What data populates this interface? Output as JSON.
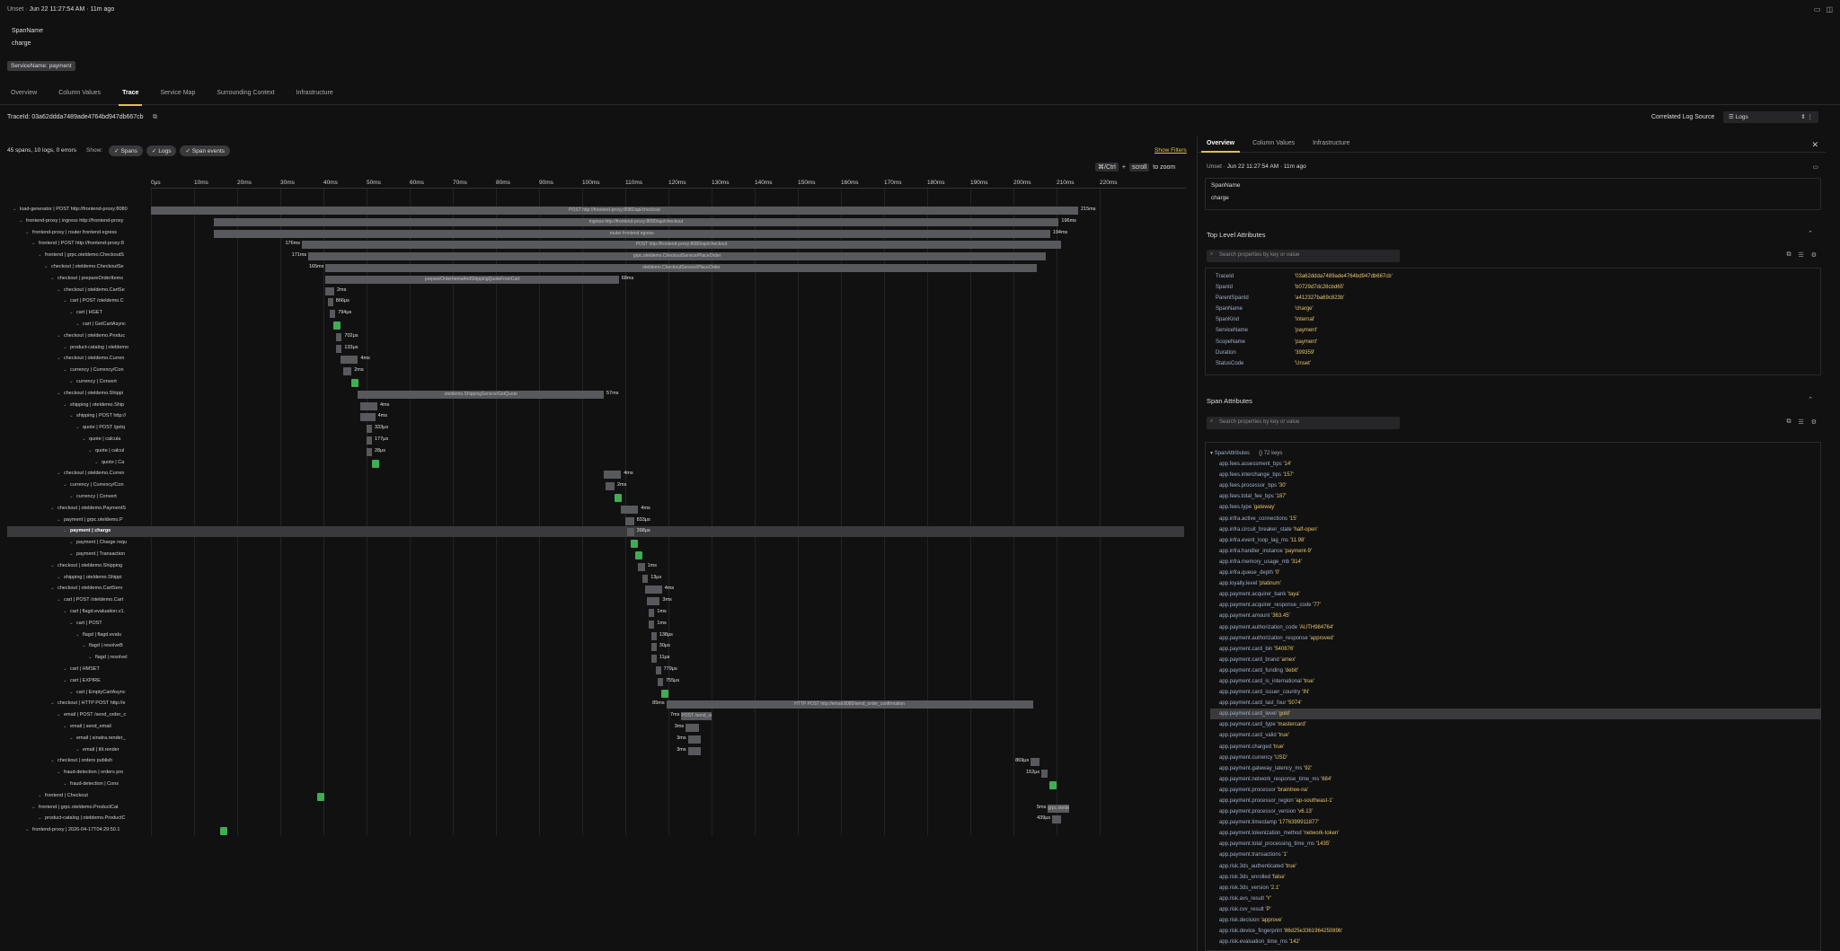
{
  "header": {
    "source": "Unset",
    "timestamp": "Jun 22 11:27:54 AM · 11m ago",
    "span_name_label": "SpanName",
    "span_name_value": "charge",
    "service_chip": "ServiceName: payment"
  },
  "tabs": [
    "Overview",
    "Column Values",
    "Trace",
    "Service Map",
    "Surrounding Context",
    "Infrastructure"
  ],
  "trace": {
    "trace_id_label": "TraceId: 03a62ddda7489ade4764bd947db667cb",
    "summary": "45 spans, 10 logs, 0 errors",
    "show_label": "Show:",
    "filters": [
      "Spans",
      "Logs",
      "Span events"
    ],
    "show_filters": "Show Filters",
    "zoom_hint_key1": "⌘/Ctrl",
    "zoom_plus": "+",
    "zoom_hint_key2": "scroll",
    "zoom_hint_text": "to zoom",
    "correlated_label": "Correlated Log Source",
    "correlated_value": "Logs"
  },
  "axis_ticks": [
    "0μs",
    "10ms",
    "20ms",
    "30ms",
    "40ms",
    "50ms",
    "60ms",
    "70ms",
    "80ms",
    "90ms",
    "100ms",
    "110ms",
    "120ms",
    "130ms",
    "140ms",
    "150ms",
    "160ms",
    "170ms",
    "180ms",
    "190ms",
    "200ms",
    "210ms",
    "220ms"
  ],
  "spans": [
    {
      "label": "load-generator | POST http://frontend-proxy:8080",
      "indent": 0,
      "bs": 0,
      "bw": 215,
      "bar_text": "POST http://frontend-proxy:8080/api/checkout",
      "dur": "215ms",
      "durside": "right"
    },
    {
      "label": "frontend-proxy | ingress http://frontend-proxy",
      "indent": 1,
      "bs": 14.5,
      "bw": 196,
      "bar_text": "ingress http://frontend-proxy:8080/api/checkout",
      "dur": "196ms",
      "durside": "right"
    },
    {
      "label": "frontend-proxy | router frontend egress",
      "indent": 2,
      "bs": 14.5,
      "bw": 194,
      "bar_text": "router frontend egress",
      "dur": "194ms",
      "durside": "right"
    },
    {
      "label": "frontend | POST http://frontend-proxy:8",
      "indent": 3,
      "bs": 35,
      "bw": 176,
      "bar_text": "POST http://frontend-proxy:8080/api/checkout",
      "dur": "176ms",
      "durside": "left"
    },
    {
      "label": "frontend | grpc.oteldemo.CheckoutS",
      "indent": 4,
      "bs": 36.5,
      "bw": 171,
      "bar_text": "grpc.oteldemo.CheckoutService/PlaceOrder",
      "dur": "171ms",
      "durside": "left"
    },
    {
      "label": "checkout | oteldemo.CheckoutSe",
      "indent": 5,
      "bs": 40.5,
      "bw": 165,
      "bar_text": "oteldemo.CheckoutService/PlaceOrder",
      "dur": "165ms",
      "durside": "left"
    },
    {
      "label": "checkout | prepareOrderItems",
      "indent": 6,
      "bs": 40.5,
      "bw": 68,
      "bar_text": "prepareOrderItemsAndShippingQuoteFromCart",
      "dur": "68ms",
      "durside": "right"
    },
    {
      "label": "checkout | oteldemo.CartSe",
      "indent": 7,
      "bs": 40.5,
      "bw": 2,
      "bar_text": "",
      "dur": "2ms",
      "durside": "right"
    },
    {
      "label": "cart | POST /oteldemo.C",
      "indent": 8,
      "bs": 41,
      "bw": 1.2,
      "bar_text": "",
      "dur": "866μs",
      "durside": "right"
    },
    {
      "label": "cart | HGET",
      "indent": 9,
      "bs": 41.5,
      "bw": 1,
      "bar_text": "",
      "dur": "794μs",
      "durside": "right"
    },
    {
      "label": "cart | GetCartAsync",
      "indent": 10,
      "bs": 42,
      "bw": 0,
      "bar_text": "",
      "dur": "",
      "durside": "",
      "ev": 42.3
    },
    {
      "label": "checkout | oteldemo.Produc",
      "indent": 7,
      "bs": 43,
      "bw": 1,
      "bar_text": "",
      "dur": "702μs",
      "durside": "right"
    },
    {
      "label": "product-catalog | oteldemo",
      "indent": 8,
      "bs": 43,
      "bw": 0.6,
      "bar_text": "",
      "dur": "133μs",
      "durside": "right"
    },
    {
      "label": "checkout | oteldemo.Curren",
      "indent": 7,
      "bs": 44,
      "bw": 4,
      "bar_text": "",
      "dur": "4ms",
      "durside": "right"
    },
    {
      "label": "currency | Currency/Con",
      "indent": 8,
      "bs": 44.5,
      "bw": 2,
      "bar_text": "",
      "dur": "2ms",
      "durside": "right"
    },
    {
      "label": "currency | Convert",
      "indent": 9,
      "bs": 0,
      "bw": 0,
      "bar_text": "",
      "dur": "",
      "durside": "",
      "ev": 46.5
    },
    {
      "label": "checkout | oteldemo.Shippi",
      "indent": 7,
      "bs": 48,
      "bw": 57,
      "bar_text": "oteldemo.ShippingService/GetQuote",
      "dur": "57ms",
      "durside": "right"
    },
    {
      "label": "shipping | oteldemo.Ship",
      "indent": 8,
      "bs": 48.5,
      "bw": 4,
      "bar_text": "",
      "dur": "4ms",
      "durside": "right"
    },
    {
      "label": "shipping | POST http://",
      "indent": 9,
      "bs": 48.5,
      "bw": 3.5,
      "bar_text": "",
      "dur": "4ms",
      "durside": "right"
    },
    {
      "label": "quote | POST /getq",
      "indent": 10,
      "bs": 50,
      "bw": 0.8,
      "bar_text": "",
      "dur": "333μs",
      "durside": "right"
    },
    {
      "label": "quote | calcula",
      "indent": 11,
      "bs": 50,
      "bw": 0.6,
      "bar_text": "",
      "dur": "177μs",
      "durside": "right"
    },
    {
      "label": "quote | calcul",
      "indent": 12,
      "bs": 50,
      "bw": 0.5,
      "bar_text": "",
      "dur": "28μs",
      "durside": "right"
    },
    {
      "label": "quote | Ca",
      "indent": 13,
      "bs": 0,
      "bw": 0,
      "bar_text": "",
      "dur": "",
      "durside": "",
      "ev": 51.2
    },
    {
      "label": "checkout | oteldemo.Curren",
      "indent": 7,
      "bs": 105,
      "bw": 4,
      "bar_text": "",
      "dur": "4ms",
      "durside": "right"
    },
    {
      "label": "currency | Currency/Con",
      "indent": 8,
      "bs": 105.5,
      "bw": 2,
      "bar_text": "",
      "dur": "2ms",
      "durside": "right"
    },
    {
      "label": "currency | Convert",
      "indent": 9,
      "bs": 0,
      "bw": 0,
      "bar_text": "",
      "dur": "",
      "durside": "",
      "ev": 107.5
    },
    {
      "label": "checkout | oteldemo.PaymentS",
      "indent": 6,
      "bs": 109,
      "bw": 4,
      "bar_text": "",
      "dur": "4ms",
      "durside": "right"
    },
    {
      "label": "payment | grpc.oteldemo.P",
      "indent": 7,
      "bs": 110,
      "bw": 2,
      "bar_text": "",
      "dur": "833μs",
      "durside": "right"
    },
    {
      "label": "payment | charge",
      "indent": 8,
      "bs": 110.5,
      "bw": 1.5,
      "bar_text": "",
      "dur": "398μs",
      "durside": "right",
      "sel": true
    },
    {
      "label": "payment | Charge requ",
      "indent": 9,
      "bs": 0,
      "bw": 0,
      "bar_text": "",
      "dur": "",
      "durside": "",
      "ev": 111.3
    },
    {
      "label": "payment | Transaction",
      "indent": 9,
      "bs": 0,
      "bw": 0,
      "bar_text": "",
      "dur": "",
      "durside": "",
      "ev": 112.2
    },
    {
      "label": "checkout | oteldemo.Shipping",
      "indent": 6,
      "bs": 113,
      "bw": 1.5,
      "bar_text": "",
      "dur": "1ms",
      "durside": "right"
    },
    {
      "label": "shipping | oteldemo.Shippi",
      "indent": 7,
      "bs": 114,
      "bw": 0.6,
      "bar_text": "",
      "dur": "13μs",
      "durside": "right"
    },
    {
      "label": "checkout | oteldemo.CartServ",
      "indent": 6,
      "bs": 114.5,
      "bw": 4,
      "bar_text": "",
      "dur": "4ms",
      "durside": "right"
    },
    {
      "label": "cart | POST /oteldemo.Cart",
      "indent": 7,
      "bs": 115,
      "bw": 3,
      "bar_text": "",
      "dur": "3ms",
      "durside": "right"
    },
    {
      "label": "cart | flagd.evaluation.v1.",
      "indent": 8,
      "bs": 115.5,
      "bw": 1,
      "bar_text": "",
      "dur": "1ms",
      "durside": "right"
    },
    {
      "label": "cart | POST",
      "indent": 9,
      "bs": 115.5,
      "bw": 1,
      "bar_text": "",
      "dur": "1ms",
      "durside": "right"
    },
    {
      "label": "flagd | flagd.evalu",
      "indent": 10,
      "bs": 116,
      "bw": 0.6,
      "bar_text": "",
      "dur": "138μs",
      "durside": "right"
    },
    {
      "label": "flagd | resolveB",
      "indent": 11,
      "bs": 116,
      "bw": 0.6,
      "bar_text": "",
      "dur": "30μs",
      "durside": "right"
    },
    {
      "label": "flagd | resolveI",
      "indent": 12,
      "bs": 116,
      "bw": 0.5,
      "bar_text": "",
      "dur": "11μs",
      "durside": "right"
    },
    {
      "label": "cart | HMSET",
      "indent": 8,
      "bs": 117,
      "bw": 0.8,
      "bar_text": "",
      "dur": "779μs",
      "durside": "right"
    },
    {
      "label": "cart | EXPIRE",
      "indent": 8,
      "bs": 117.5,
      "bw": 0.8,
      "bar_text": "",
      "dur": "755μs",
      "durside": "right"
    },
    {
      "label": "cart | EmptyCartAsync",
      "indent": 9,
      "bs": 0,
      "bw": 0,
      "bar_text": "",
      "dur": "",
      "durside": "",
      "ev": 118.3
    },
    {
      "label": "checkout | HTTP POST http://e",
      "indent": 6,
      "bs": 119.5,
      "bw": 85,
      "bar_text": "HTTP POST http://email:8080/send_order_confirmation",
      "dur": "85ms",
      "durside": "left"
    },
    {
      "label": "email | POST /send_order_c",
      "indent": 7,
      "bs": 123,
      "bw": 7,
      "bar_text": "POST /send_order_confirmation",
      "dur": "7ms",
      "durside": "left"
    },
    {
      "label": "email | send_email",
      "indent": 8,
      "bs": 124,
      "bw": 3,
      "bar_text": "",
      "dur": "3ms",
      "durside": "left"
    },
    {
      "label": "email | sinatra.render_",
      "indent": 9,
      "bs": 124.5,
      "bw": 3,
      "bar_text": "",
      "dur": "3ms",
      "durside": "left"
    },
    {
      "label": "email | tilt.render",
      "indent": 10,
      "bs": 124.5,
      "bw": 3,
      "bar_text": "",
      "dur": "3ms",
      "durside": "left"
    },
    {
      "label": "checkout | orders publish",
      "indent": 6,
      "bs": 204,
      "bw": 2,
      "bar_text": "",
      "dur": "869μs",
      "durside": "left"
    },
    {
      "label": "fraud-detection | orders pro",
      "indent": 7,
      "bs": 206.5,
      "bw": 1.5,
      "bar_text": "",
      "dur": "152μs",
      "durside": "left"
    },
    {
      "label": "fraud-detection | Cons",
      "indent": 8,
      "bs": 0,
      "bw": 0,
      "bar_text": "",
      "dur": "",
      "durside": "",
      "ev": 208.3
    },
    {
      "label": "frontend | Checkout",
      "indent": 4,
      "bs": 0,
      "bw": 0,
      "bar_text": "",
      "dur": "",
      "durside": "",
      "ev": 38.5
    },
    {
      "label": "frontend | grpc.oteldemo.ProductCat",
      "indent": 3,
      "bs": 208,
      "bw": 5,
      "bar_text": "grpc.oteldemo.ProductCatalog",
      "dur": "5ms",
      "durside": "left"
    },
    {
      "label": "product-catalog | oteldemo.ProductC",
      "indent": 4,
      "bs": 209,
      "bw": 2,
      "bar_text": "",
      "dur": "439μs",
      "durside": "left"
    },
    {
      "label": "frontend-proxy | 2026-04-17T04:29:50.1",
      "indent": 2,
      "bs": 0,
      "bw": 0,
      "bar_text": "",
      "dur": "",
      "durside": "",
      "ev": 16
    }
  ],
  "panel": {
    "tabs": [
      "Overview",
      "Column Values",
      "Infrastructure"
    ],
    "source": "Unset",
    "timestamp": "Jun 22 11:27:54 AM · 11m ago",
    "span_name_label": "SpanName",
    "span_name_value": "charge",
    "top_level_title": "Top Level Attributes",
    "search_placeholder": "Search properties by key or value",
    "top_level": [
      {
        "k": "TraceId",
        "v": "'03a62ddda7489ade4764bd947db667cb'"
      },
      {
        "k": "SpanId",
        "v": "'b0729d7dc28cbd65'"
      },
      {
        "k": "ParentSpanId",
        "v": "'a412327ba69c823b'"
      },
      {
        "k": "SpanName",
        "v": "'charge'"
      },
      {
        "k": "SpanKind",
        "v": "'Internal'"
      },
      {
        "k": "ServiceName",
        "v": "'payment'"
      },
      {
        "k": "ScopeName",
        "v": "'payment'"
      },
      {
        "k": "Duration",
        "v": "'399359'"
      },
      {
        "k": "StatusCode",
        "v": "'Unset'"
      }
    ],
    "span_attr_title": "Span Attributes",
    "span_attr_root": "SpanAttributes",
    "span_attr_count": "{} 72 keys",
    "span_attrs": [
      {
        "k": "app.fees.assessment_bps",
        "v": "'14'"
      },
      {
        "k": "app.fees.interchange_bps",
        "v": "'157'"
      },
      {
        "k": "app.fees.processor_bps",
        "v": "'30'"
      },
      {
        "k": "app.fees.total_fee_bps",
        "v": "'187'"
      },
      {
        "k": "app.fees.type",
        "v": "'gateway'"
      },
      {
        "k": "app.infra.active_connections",
        "v": "'15'"
      },
      {
        "k": "app.infra.circuit_breaker_state",
        "v": "'half-open'"
      },
      {
        "k": "app.infra.event_loop_lag_ms",
        "v": "'11.98'"
      },
      {
        "k": "app.infra.handler_instance",
        "v": "'payment-9'"
      },
      {
        "k": "app.infra.memory_usage_mb",
        "v": "'314'"
      },
      {
        "k": "app.infra.queue_depth",
        "v": "'0'"
      },
      {
        "k": "app.loyalty.level",
        "v": "'platinum'"
      },
      {
        "k": "app.payment.acquirer_bank",
        "v": "'taya'"
      },
      {
        "k": "app.payment.acquirer_response_code",
        "v": "'77'"
      },
      {
        "k": "app.payment.amount",
        "v": "'363.45'"
      },
      {
        "k": "app.payment.authorization_code",
        "v": "'AUTH984764'"
      },
      {
        "k": "app.payment.authorization_response",
        "v": "'approved'"
      },
      {
        "k": "app.payment.card_bin",
        "v": "'540876'"
      },
      {
        "k": "app.payment.card_brand",
        "v": "'amex'"
      },
      {
        "k": "app.payment.card_funding",
        "v": "'debit'"
      },
      {
        "k": "app.payment.card_is_international",
        "v": "'true'"
      },
      {
        "k": "app.payment.card_issuer_country",
        "v": "'IN'"
      },
      {
        "k": "app.payment.card_last_four",
        "v": "'5074'"
      },
      {
        "k": "app.payment.card_level",
        "v": "'gold'",
        "hl": true
      },
      {
        "k": "app.payment.card_type",
        "v": "'mastercard'"
      },
      {
        "k": "app.payment.card_valid",
        "v": "'true'"
      },
      {
        "k": "app.payment.charged",
        "v": "'true'"
      },
      {
        "k": "app.payment.currency",
        "v": "'USD'"
      },
      {
        "k": "app.payment.gateway_latency_ms",
        "v": "'92'"
      },
      {
        "k": "app.payment.network_response_time_ms",
        "v": "'684'"
      },
      {
        "k": "app.payment.processor",
        "v": "'braintree-na'"
      },
      {
        "k": "app.payment.processor_region",
        "v": "'ap-southeast-1'"
      },
      {
        "k": "app.payment.processor_version",
        "v": "'v6.13'"
      },
      {
        "k": "app.payment.timestamp",
        "v": "'1776399911877'"
      },
      {
        "k": "app.payment.tokenization_method",
        "v": "'network-token'"
      },
      {
        "k": "app.payment.total_processing_time_ms",
        "v": "'1435'"
      },
      {
        "k": "app.payment.transactions",
        "v": "'1'"
      },
      {
        "k": "app.risk.3ds_authenticated",
        "v": "'true'"
      },
      {
        "k": "app.risk.3ds_enrolled",
        "v": "'false'"
      },
      {
        "k": "app.risk.3ds_version",
        "v": "'2.1'"
      },
      {
        "k": "app.risk.avs_result",
        "v": "'Y'"
      },
      {
        "k": "app.risk.cvv_result",
        "v": "'P'"
      },
      {
        "k": "app.risk.decision",
        "v": "'approve'"
      },
      {
        "k": "app.risk.device_fingerprint",
        "v": "'86d25e336196425089b'"
      },
      {
        "k": "app.risk.evaluation_time_ms",
        "v": "'142'"
      }
    ]
  }
}
